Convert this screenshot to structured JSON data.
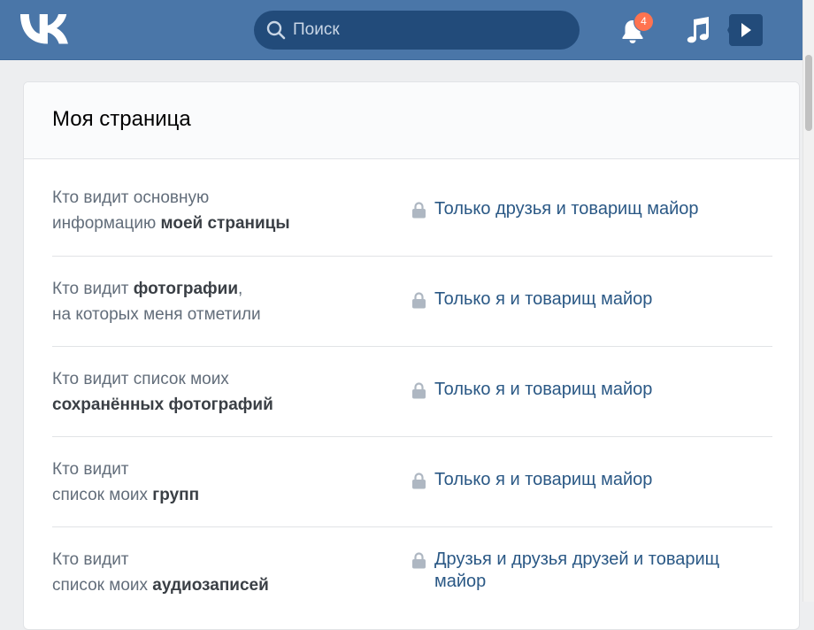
{
  "header": {
    "logo_text": "VK",
    "search": {
      "placeholder": "Поиск",
      "value": ""
    },
    "notifications": {
      "count": "4"
    },
    "brand_color": "#4a76a8"
  },
  "card": {
    "title": "Моя страница"
  },
  "settings": [
    {
      "label_parts": [
        "Кто видит основную",
        "информацию ",
        "моей страницы",
        ""
      ],
      "value": "Только друзья и товарищ майор"
    },
    {
      "label_parts": [
        "Кто видит ",
        "фотографии",
        ",",
        "на которых меня отметили"
      ],
      "value": "Только я и товарищ майор"
    },
    {
      "label_parts": [
        "Кто видит список моих",
        "",
        "сохранённых фотографий",
        ""
      ],
      "value": "Только я и товарищ майор"
    },
    {
      "label_parts": [
        "Кто видит",
        "список моих ",
        "групп",
        ""
      ],
      "value": "Только я и товарищ майор"
    },
    {
      "label_parts": [
        "Кто видит",
        "список моих ",
        "аудиозаписей",
        ""
      ],
      "value": "Друзья и друзья друзей и товарищ майор"
    }
  ]
}
